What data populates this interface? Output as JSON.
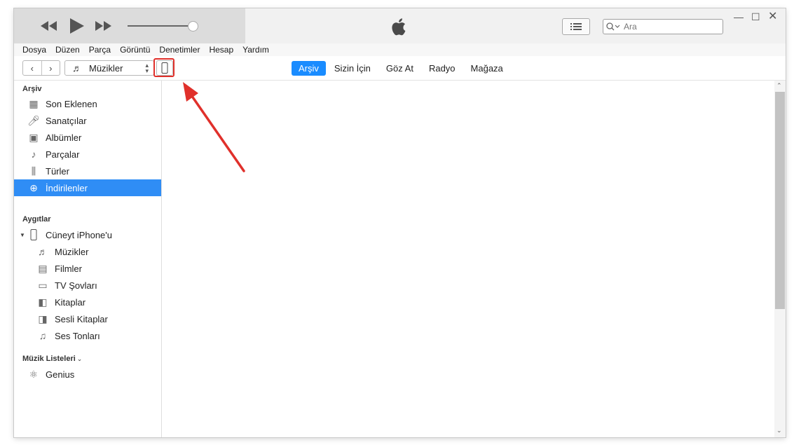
{
  "search": {
    "placeholder": "Ara"
  },
  "menu": [
    "Dosya",
    "Düzen",
    "Parça",
    "Görüntü",
    "Denetimler",
    "Hesap",
    "Yardım"
  ],
  "toolbar": {
    "media_selector": "Müzikler"
  },
  "tabs": [
    "Arşiv",
    "Sizin İçin",
    "Göz At",
    "Radyo",
    "Mağaza"
  ],
  "sidebar": {
    "library_title": "Arşiv",
    "library": [
      {
        "label": "Son Eklenen",
        "icon": "grid-icon"
      },
      {
        "label": "Sanatçılar",
        "icon": "microphone-icon"
      },
      {
        "label": "Albümler",
        "icon": "album-icon"
      },
      {
        "label": "Parçalar",
        "icon": "note-icon"
      },
      {
        "label": "Türler",
        "icon": "genres-icon"
      },
      {
        "label": "İndirilenler",
        "icon": "download-icon"
      }
    ],
    "devices_title": "Aygıtlar",
    "device": {
      "label": "Cüneyt iPhone'u"
    },
    "device_items": [
      {
        "label": "Müzikler",
        "icon": "note-icon"
      },
      {
        "label": "Filmler",
        "icon": "film-icon"
      },
      {
        "label": "TV Şovları",
        "icon": "tv-icon"
      },
      {
        "label": "Kitaplar",
        "icon": "book-icon"
      },
      {
        "label": "Sesli Kitaplar",
        "icon": "audiobook-icon"
      },
      {
        "label": "Ses Tonları",
        "icon": "bell-icon"
      }
    ],
    "playlists_title": "Müzik Listeleri",
    "playlists": [
      {
        "label": "Genius",
        "icon": "atom-icon"
      }
    ]
  },
  "colors": {
    "accent": "#1a8cff",
    "selection": "#2f8df5",
    "annotation": "#e0302b"
  }
}
